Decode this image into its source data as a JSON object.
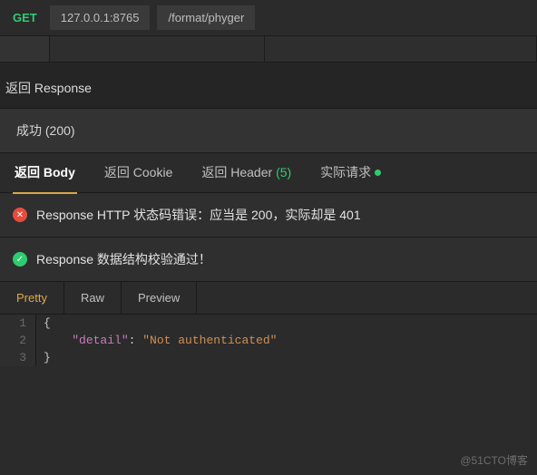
{
  "request": {
    "method": "GET",
    "host": "127.0.0.1:8765",
    "path": "/format/phyger"
  },
  "section_title": "返回 Response",
  "status_text": "成功 (200)",
  "tabs": {
    "body": "返回 Body",
    "cookie": "返回 Cookie",
    "header": "返回 Header",
    "header_count": "(5)",
    "actual": "实际请求"
  },
  "messages": {
    "error": "Response HTTP 状态码错误：应当是 200，实际却是 401",
    "ok": "Response 数据结构校验通过！"
  },
  "view_tabs": {
    "pretty": "Pretty",
    "raw": "Raw",
    "preview": "Preview"
  },
  "code": {
    "l1_num": "1",
    "l1_text": "{",
    "l2_num": "2",
    "l2_indent": "    ",
    "l2_key": "\"detail\"",
    "l2_colon": ": ",
    "l2_val": "\"Not authenticated\"",
    "l3_num": "3",
    "l3_text": "}"
  },
  "watermark": "@51CTO博客"
}
